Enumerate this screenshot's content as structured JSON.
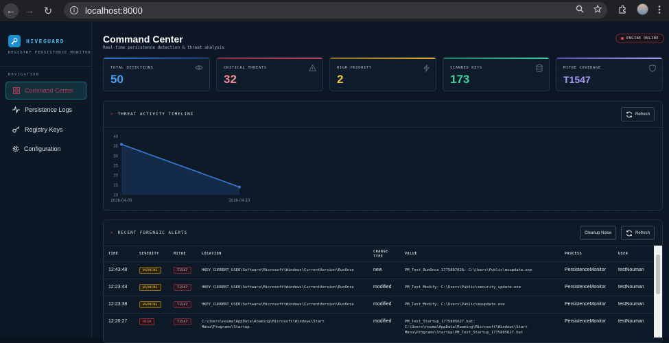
{
  "browser": {
    "url": "localhost:8000"
  },
  "brand": {
    "name": "HIVEGUARD",
    "subtitle": "REGISTRY PERSISTENCE MONITOR"
  },
  "sidebar": {
    "section_label": "NAVIGATION",
    "items": [
      {
        "label": "Command Center",
        "icon": "grid-icon",
        "active": true
      },
      {
        "label": "Persistence Logs",
        "icon": "activity-icon",
        "active": false
      },
      {
        "label": "Registry Keys",
        "icon": "key-icon",
        "active": false
      },
      {
        "label": "Configuration",
        "icon": "gear-icon",
        "active": false
      }
    ]
  },
  "header": {
    "title": "Command Center",
    "subtitle": "Real-time persistence detection & threat analysis",
    "status": "ENGINE ONLINE"
  },
  "stats": [
    {
      "label": "TOTAL DETECTIONS",
      "value": "50",
      "color": "#4f9ef0",
      "icon": "eye-icon"
    },
    {
      "label": "CRITICAL THREATS",
      "value": "32",
      "color": "#f08a96",
      "icon": "warning-icon"
    },
    {
      "label": "HIGH PRIORITY",
      "value": "2",
      "color": "#f0c040",
      "icon": "bolt-icon"
    },
    {
      "label": "SCANNED KEYS",
      "value": "173",
      "color": "#3fd09a",
      "icon": "database-icon"
    },
    {
      "label": "MITRE COVERAGE",
      "value": "T1547",
      "color": "#a99cf5",
      "icon": "shield-icon"
    }
  ],
  "timeline": {
    "title": "THREAT ACTIVITY TIMELINE",
    "refresh_label": "Refresh"
  },
  "chart_data": {
    "type": "area",
    "x": [
      "2026-04-09",
      "2026-04-10"
    ],
    "series": [
      {
        "values": [
          36,
          14
        ]
      }
    ],
    "ylim": [
      10,
      40
    ],
    "yticks": [
      "40",
      "35",
      "30",
      "25",
      "20",
      "15",
      "10"
    ],
    "xticks": [
      "2026-04-09",
      "2026-04-10"
    ],
    "grid": false,
    "color": "#3a7bd5"
  },
  "alerts": {
    "title": "RECENT FORENSIC ALERTS",
    "cleanup_label": "Cleanup Noise",
    "refresh_label": "Refresh",
    "columns": [
      "TIME",
      "SEVERITY",
      "MITRE",
      "LOCATION",
      "CHANGE TYPE",
      "VALUE",
      "PROCESS",
      "USER"
    ],
    "rows": [
      {
        "time": "12:43:48",
        "severity": "WARNING",
        "mitre": "T1547",
        "location": "HKEY_CURRENT_USER\\Software\\Microsoft\\Windows\\CurrentVersion\\RunOnce",
        "change": "new",
        "value": "PM_Test_RunOnce_1775807026: C:\\Users\\Public\\msupdate.exe",
        "process": "PersistenceMonitor",
        "user": "testNouman"
      },
      {
        "time": "12:23:43",
        "severity": "WARNING",
        "mitre": "T1547",
        "location": "HKEY_CURRENT_USER\\Software\\Microsoft\\Windows\\CurrentVersion\\RunOnce",
        "change": "modified",
        "value": "PM_Test_Modify: C:\\Users\\Public\\security_update.exe",
        "process": "PersistenceMonitor",
        "user": "testNouman"
      },
      {
        "time": "12:23:38",
        "severity": "WARNING",
        "mitre": "T1547",
        "location": "HKEY_CURRENT_USER\\Software\\Microsoft\\Windows\\CurrentVersion\\RunOnce",
        "change": "modified",
        "value": "PM_Test_Modify: C:\\Users\\Public\\msupdate.exe",
        "process": "PersistenceMonitor",
        "user": "testNouman"
      },
      {
        "time": "12:20:27",
        "severity": "HIGH",
        "mitre": "T1547",
        "location": "C:\\Users\\nouma\\AppData\\Roaming\\Microsoft\\Windows\\Start Menu\\Programs\\Startup",
        "change": "modified",
        "value": "PM_Test_Startup_1775805627.bat: C:\\Users\\nouma\\AppData\\Roaming\\Microsoft\\Windows\\Start Menu\\Programs\\Startup\\PM_Test_Startup_1775805627.bat",
        "process": "PersistenceMonitor",
        "user": "testNouman"
      }
    ]
  }
}
